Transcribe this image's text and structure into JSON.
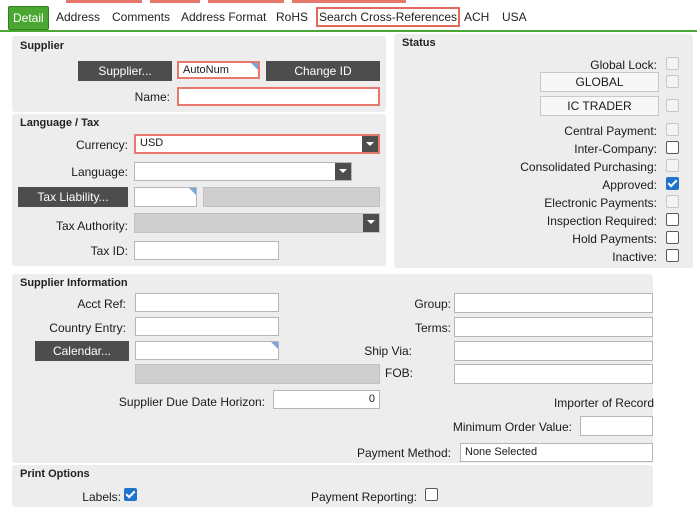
{
  "tabs": [
    {
      "label": "Detail"
    },
    {
      "label": "Address"
    },
    {
      "label": "Comments"
    },
    {
      "label": "Address Format"
    },
    {
      "label": "RoHS"
    },
    {
      "label": "Search Cross-References"
    },
    {
      "label": "ACH"
    },
    {
      "label": "USA"
    }
  ],
  "supplier": {
    "title": "Supplier",
    "supplier_button": "Supplier...",
    "supplier_id_value": "AutoNum",
    "change_id_button": "Change ID",
    "name_label": "Name:",
    "name_value": ""
  },
  "language_tax": {
    "title": "Language / Tax",
    "currency_label": "Currency:",
    "currency_value": "USD",
    "language_label": "Language:",
    "language_value": "",
    "tax_liability_button": "Tax Liability...",
    "tax_authority_label": "Tax Authority:",
    "tax_id_label": "Tax ID:",
    "tax_id_value": ""
  },
  "status": {
    "title": "Status",
    "global_lock_label": "Global Lock:",
    "global_button": "GLOBAL",
    "ic_trader_button": "IC TRADER",
    "central_payment_label": "Central Payment:",
    "inter_company_label": "Inter-Company:",
    "consolidated_purchasing_label": "Consolidated Purchasing:",
    "approved_label": "Approved:",
    "electronic_payments_label": "Electronic Payments:",
    "inspection_required_label": "Inspection Required:",
    "hold_payments_label": "Hold Payments:",
    "inactive_label": "Inactive:",
    "checked": {
      "approved": true
    }
  },
  "supplier_info": {
    "title": "Supplier Information",
    "acct_ref_label": "Acct Ref:",
    "country_entry_label": "Country Entry:",
    "calendar_button": "Calendar...",
    "due_date_horizon_label": "Supplier Due Date Horizon:",
    "due_date_horizon_value": "0",
    "group_label": "Group:",
    "terms_label": "Terms:",
    "ship_via_label": "Ship Via:",
    "fob_label": "FOB:",
    "importer_of_record_label": "Importer of Record",
    "minimum_order_value_label": "Minimum Order Value:",
    "payment_method_label": "Payment Method:",
    "payment_method_value": "None Selected"
  },
  "print_options": {
    "title": "Print Options",
    "labels_label": "Labels:",
    "labels_checked": true,
    "payment_reporting_label": "Payment Reporting:",
    "payment_reporting_checked": false
  },
  "colors": {
    "accent_green": "#4aa832",
    "required_red": "#e8786d",
    "button_dark": "#4d4d4d",
    "checkbox_blue": "#1f74c9",
    "panel_grey": "#ededed"
  }
}
